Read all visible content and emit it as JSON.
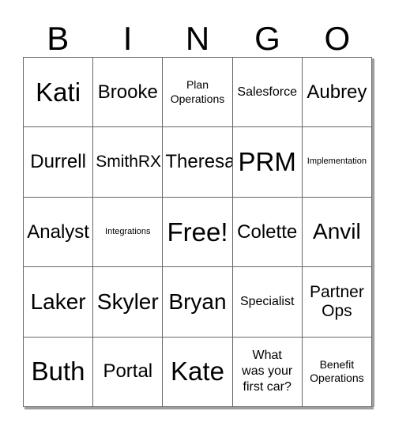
{
  "card": {
    "title": "BINGO",
    "header_letters": [
      "B",
      "I",
      "N",
      "G",
      "O"
    ],
    "free_space_label": "Free!",
    "colors": {
      "background": "#ffffff",
      "text": "#000000",
      "grid_line": "#666666",
      "shadow": "#8d8d8d"
    },
    "rows": [
      [
        {
          "text": "Kati",
          "size": "sz-xl"
        },
        {
          "text": "Brooke",
          "size": "sz-md"
        },
        {
          "text": "Plan\nOperations",
          "size": "sz-xxs"
        },
        {
          "text": "Salesforce",
          "size": "sz-xs"
        },
        {
          "text": "Aubrey",
          "size": "sz-md"
        }
      ],
      [
        {
          "text": "Durrell",
          "size": "sz-md"
        },
        {
          "text": "SmithRX",
          "size": "sz-sm"
        },
        {
          "text": "Theresa",
          "size": "sz-md"
        },
        {
          "text": "PRM",
          "size": "sz-xl"
        },
        {
          "text": "Implementation",
          "size": "sz-tiny"
        }
      ],
      [
        {
          "text": "Analyst",
          "size": "sz-md"
        },
        {
          "text": "Integrations",
          "size": "sz-tiny"
        },
        {
          "text": "Free!",
          "size": "sz-xl"
        },
        {
          "text": "Colette",
          "size": "sz-md"
        },
        {
          "text": "Anvil",
          "size": "sz-lg"
        }
      ],
      [
        {
          "text": "Laker",
          "size": "sz-lg"
        },
        {
          "text": "Skyler",
          "size": "sz-lg"
        },
        {
          "text": "Bryan",
          "size": "sz-lg"
        },
        {
          "text": "Specialist",
          "size": "sz-xs"
        },
        {
          "text": "Partner\nOps",
          "size": "sz-sm"
        }
      ],
      [
        {
          "text": "Buth",
          "size": "sz-xl"
        },
        {
          "text": "Portal",
          "size": "sz-md"
        },
        {
          "text": "Kate",
          "size": "sz-xl"
        },
        {
          "text": "What\nwas your\nfirst car?",
          "size": "sz-xs"
        },
        {
          "text": "Benefit\nOperations",
          "size": "sz-xxs"
        }
      ]
    ]
  }
}
